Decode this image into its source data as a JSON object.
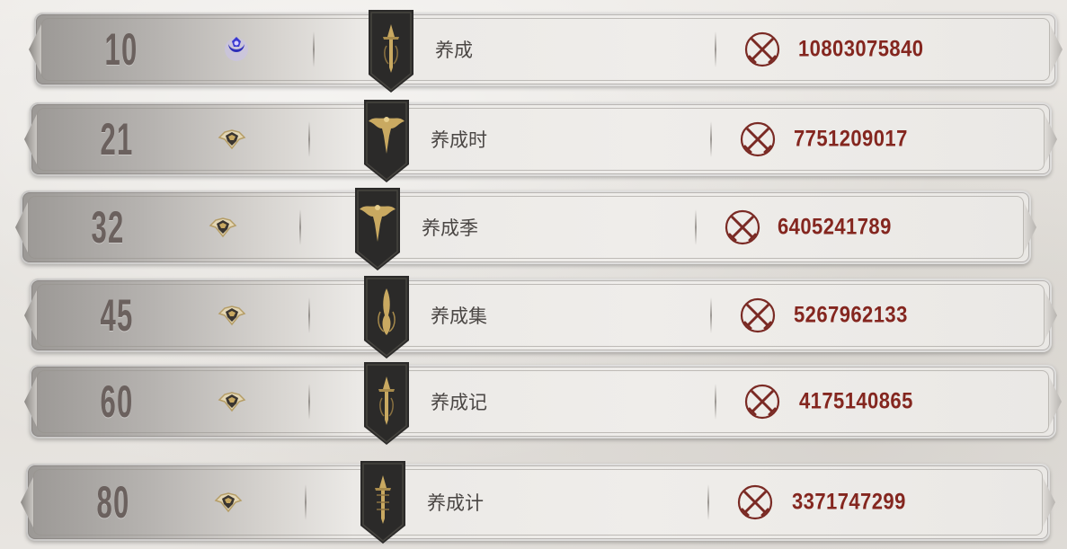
{
  "ranking": {
    "rows": [
      {
        "rank": "10",
        "tier": "crescent-emblem",
        "name": "养成",
        "power": "10803075840"
      },
      {
        "rank": "21",
        "tier": "helm-emblem",
        "name": "养成时",
        "power": "7751209017"
      },
      {
        "rank": "32",
        "tier": "helm-emblem",
        "name": "养成季",
        "power": "6405241789"
      },
      {
        "rank": "45",
        "tier": "helm-emblem",
        "name": "养成集",
        "power": "5267962133"
      },
      {
        "rank": "60",
        "tier": "helm-emblem",
        "name": "养成记",
        "power": "4175140865"
      },
      {
        "rank": "80",
        "tier": "helm-emblem",
        "name": "养成计",
        "power": "3371747299"
      }
    ]
  },
  "colors": {
    "power_text": "#84261f",
    "rank_text": "#6b615e",
    "banner": "#2b2a29",
    "gold": "#c9a961"
  },
  "icons": {
    "power": "crossed-swords-icon",
    "banner": "guild-banner-icon"
  }
}
